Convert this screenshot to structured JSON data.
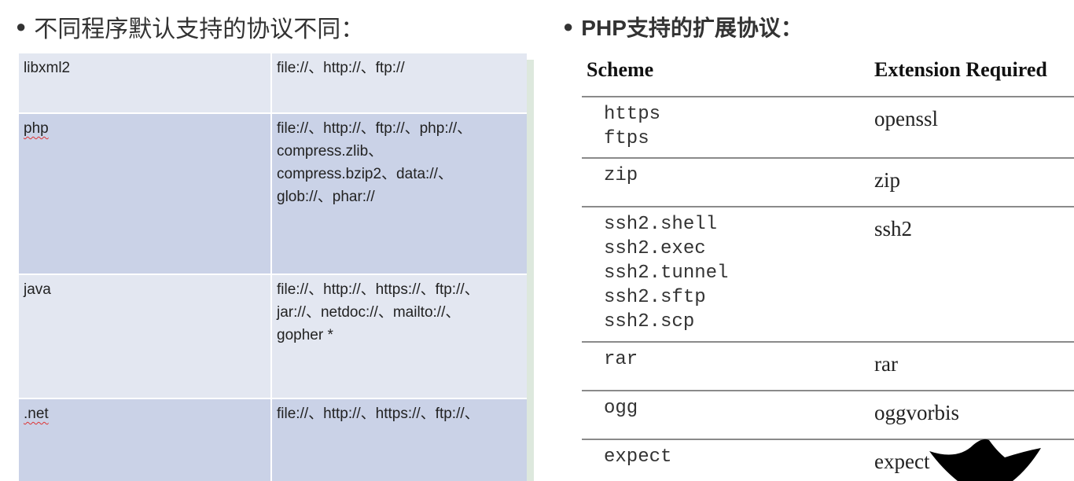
{
  "left_heading": "不同程序默认支持的协议不同：",
  "right_heading": "PHP支持的扩展协议：",
  "left_table": {
    "rows": [
      {
        "program": "libxml2",
        "protocols": [
          "file://、http://、ftp://"
        ]
      },
      {
        "program": "php",
        "protocols": [
          "file://、http://、ftp://、php://、",
          "compress.zlib、",
          "compress.bzip2、data://、",
          "glob://、phar://"
        ]
      },
      {
        "program": "java",
        "protocols": [
          "file://、http://、https://、ftp://、",
          "jar://、netdoc://、mailto://、",
          "gopher *"
        ]
      },
      {
        "program": ".net",
        "protocols": [
          "file://、http://、https://、ftp://、"
        ]
      }
    ]
  },
  "right_table": {
    "headers": {
      "scheme": "Scheme",
      "extension": "Extension Required"
    },
    "rows": [
      {
        "schemes": [
          "https",
          "ftps"
        ],
        "extension": "openssl"
      },
      {
        "schemes": [
          "zip"
        ],
        "extension": "zip"
      },
      {
        "schemes": [
          "ssh2.shell",
          "ssh2.exec",
          "ssh2.tunnel",
          "ssh2.sftp",
          "ssh2.scp"
        ],
        "extension": "ssh2"
      },
      {
        "schemes": [
          "rar"
        ],
        "extension": "rar"
      },
      {
        "schemes": [
          "ogg"
        ],
        "extension": "oggvorbis"
      },
      {
        "schemes": [
          "expect"
        ],
        "extension": "expect"
      }
    ]
  },
  "colors": {
    "row_light": "#e3e7f1",
    "row_dark": "#cad2e7",
    "rule": "#8a8a8a"
  }
}
